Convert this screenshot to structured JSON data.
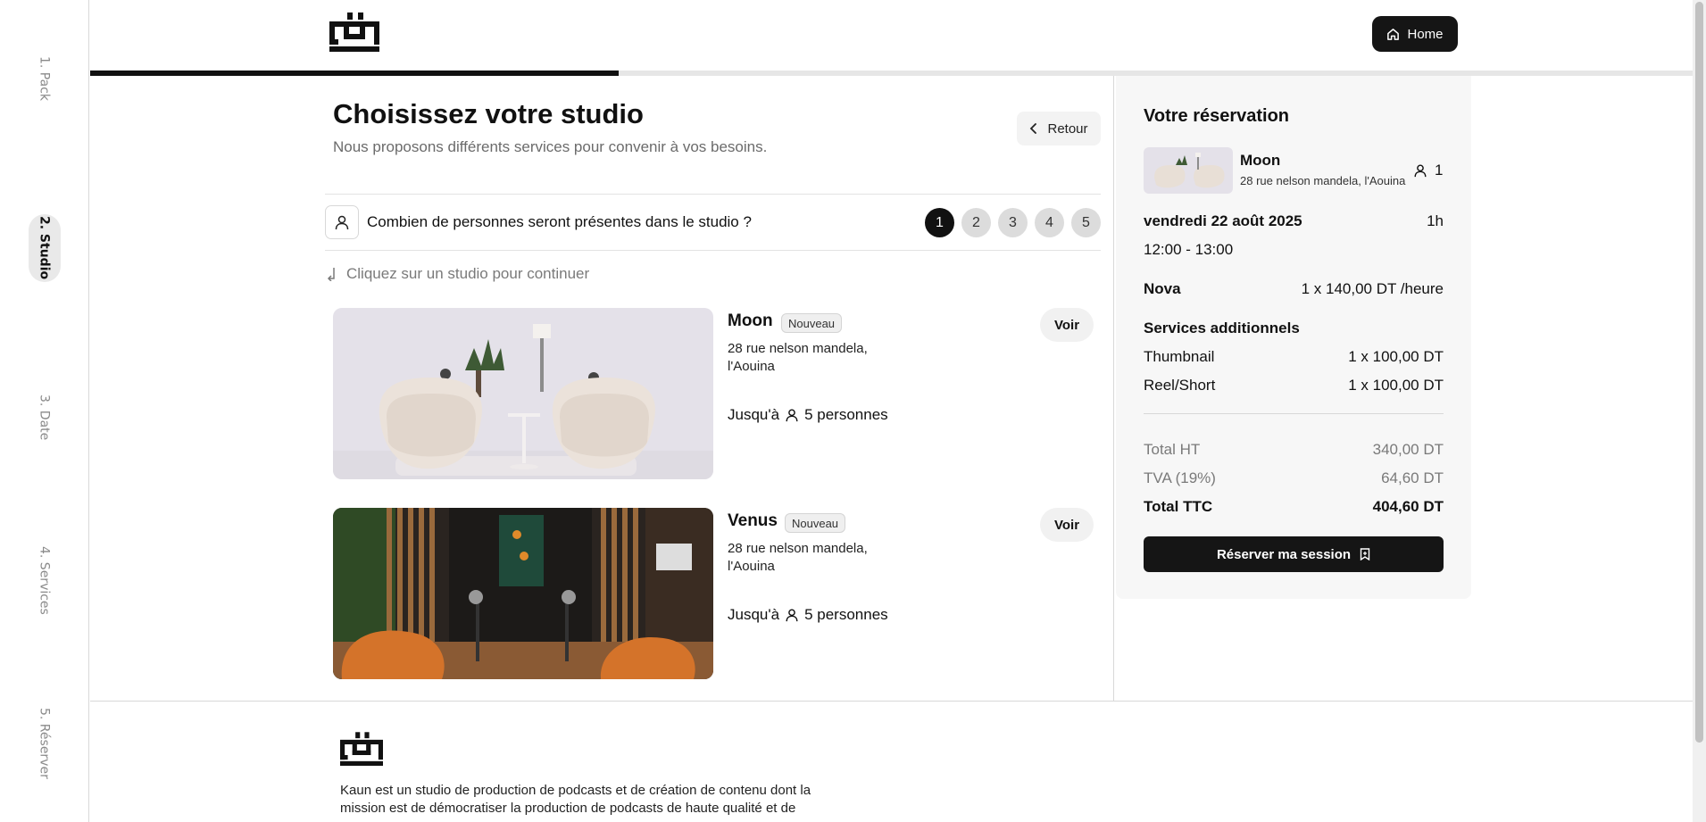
{
  "steps": [
    {
      "label": "1. Pack"
    },
    {
      "label": "2. Studio"
    },
    {
      "label": "3. Date"
    },
    {
      "label": "4. Services"
    },
    {
      "label": "5. Réserver"
    }
  ],
  "header": {
    "home_label": "Home"
  },
  "progress_fraction": 0.33,
  "main": {
    "title": "Choisissez votre studio",
    "subtitle": "Nous proposons différents services pour convenir à vos besoins.",
    "back_label": "Retour",
    "people_question": "Combien de personnes seront présentes dans le studio ?",
    "people_options": [
      "1",
      "2",
      "3",
      "4",
      "5"
    ],
    "people_selected": "1",
    "hint": "Cliquez sur un studio pour continuer",
    "studios": [
      {
        "name": "Moon",
        "badge": "Nouveau",
        "address": "28 rue nelson mandela, l'Aouina",
        "capacity_prefix": "Jusqu'à",
        "capacity": "5 personnes",
        "button": "Voir"
      },
      {
        "name": "Venus",
        "badge": "Nouveau",
        "address": "28 rue nelson mandela, l'Aouina",
        "capacity_prefix": "Jusqu'à",
        "capacity": "5 personnes",
        "button": "Voir"
      }
    ]
  },
  "reservation": {
    "title": "Votre réservation",
    "studio_name": "Moon",
    "studio_address": "28 rue nelson mandela, l'Aouina",
    "guests": "1",
    "date": "vendredi 22 août 2025",
    "duration": "1h",
    "time": "12:00 - 13:00",
    "pack_name": "Nova",
    "pack_price": "1 x 140,00 DT /heure",
    "services_title": "Services additionnels",
    "services": [
      {
        "name": "Thumbnail",
        "price": "1 x 100,00 DT"
      },
      {
        "name": "Reel/Short",
        "price": "1 x 100,00 DT"
      }
    ],
    "total_ht_label": "Total HT",
    "total_ht": "340,00 DT",
    "tva_label": "TVA (19%)",
    "tva": "64,60 DT",
    "total_ttc_label": "Total TTC",
    "total_ttc": "404,60 DT",
    "reserve_label": "Réserver ma session"
  },
  "footer": {
    "description_line1": "Kaun est un studio de production de podcasts et de création de contenu dont la",
    "description_line2": "mission est de démocratiser la production de podcasts de haute qualité et de"
  },
  "colors": {
    "accent": "#151515",
    "panel_bg": "#f7f7f7",
    "muted": "#7a7a7a"
  }
}
